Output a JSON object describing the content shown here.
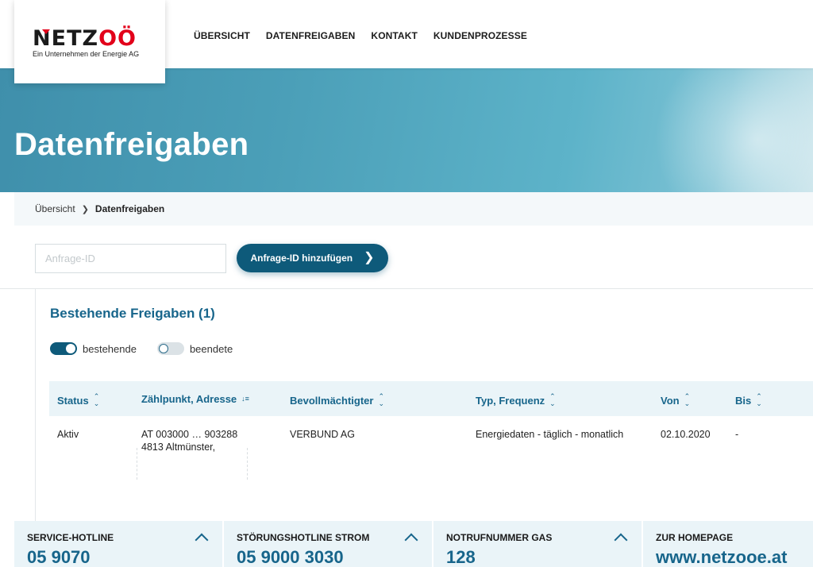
{
  "logo": {
    "part1": "N",
    "part2": "E",
    "part3": "T",
    "part4": "Z",
    "part5": "OÖ",
    "subtitle": "Ein Unternehmen der Energie AG"
  },
  "nav": [
    {
      "label": "Übersicht"
    },
    {
      "label": "Datenfreigaben"
    },
    {
      "label": "Kontakt"
    },
    {
      "label": "Kundenprozesse"
    }
  ],
  "hero": {
    "title": "Datenfreigaben"
  },
  "breadcrumb": {
    "home": "Übersicht",
    "current": "Datenfreigaben"
  },
  "request": {
    "placeholder": "Anfrage-ID",
    "button_label": "Anfrage-ID hinzufügen"
  },
  "panel": {
    "title": "Bestehende Freigaben (1)",
    "toggles": [
      {
        "label": "bestehende",
        "on": true
      },
      {
        "label": "beendete",
        "on": false
      }
    ]
  },
  "table": {
    "columns": [
      {
        "label": "Status"
      },
      {
        "label": "Zählpunkt, Adresse"
      },
      {
        "label": "Bevollmächtigter"
      },
      {
        "label": "Typ, Frequenz"
      },
      {
        "label": "Von"
      },
      {
        "label": "Bis"
      }
    ],
    "rows": [
      {
        "status": "Aktiv",
        "zaehlpunkt": "AT 003000 … 903288",
        "adresse": "4813 Altmünster,",
        "bevollmaechtigter": "VERBUND AG",
        "typ": "Energiedaten - täglich - monatlich",
        "von": "02.10.2020",
        "bis": "-"
      }
    ]
  },
  "footer": [
    {
      "label": "Service-Hotline",
      "value": "05 9070"
    },
    {
      "label": "Störungshotline Strom",
      "value": "05 9000 3030"
    },
    {
      "label": "Notrufnummer Gas",
      "value": "128"
    },
    {
      "label": "Zur Homepage",
      "value": "www.netzooe.at"
    }
  ],
  "colors": {
    "primary": "#0e5a7a",
    "accent_text": "#17658b",
    "brand_red": "#e2001a"
  }
}
